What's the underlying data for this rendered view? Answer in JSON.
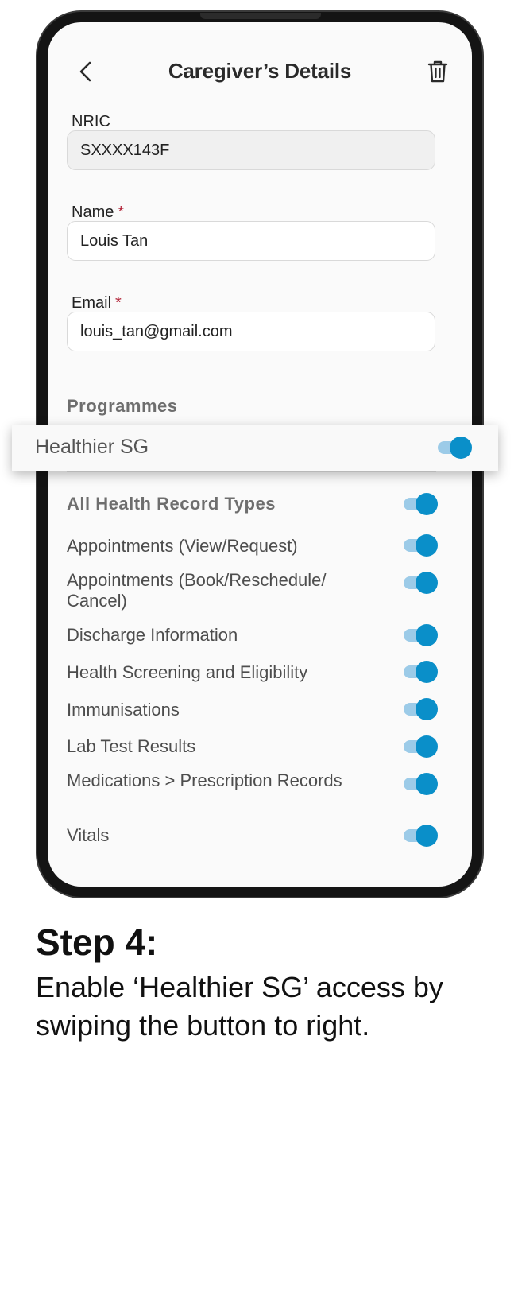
{
  "header": {
    "title": "Caregiver’s Details"
  },
  "form": {
    "nric": {
      "label": "NRIC",
      "value": "SXXXX143F"
    },
    "name": {
      "label": "Name",
      "required_mark": "*",
      "value": "Louis Tan"
    },
    "email": {
      "label": "Email",
      "required_mark": "*",
      "value": "louis_tan@gmail.com"
    }
  },
  "programmes": {
    "heading": "Programmes",
    "highlight": {
      "label": "Healthier SG",
      "enabled": true
    }
  },
  "records": {
    "all": {
      "label": "All Health Record Types",
      "enabled": true
    },
    "items": [
      {
        "label": "Appointments (View/Request)",
        "enabled": true
      },
      {
        "label": "Appointments (Book/Reschedule/ Cancel)",
        "enabled": true
      },
      {
        "label": "Discharge Information",
        "enabled": true
      },
      {
        "label": "Health Screening and Eligibility",
        "enabled": true
      },
      {
        "label": "Immunisations",
        "enabled": true
      },
      {
        "label": "Lab Test Results",
        "enabled": true
      },
      {
        "label": "Medications > Prescription Records",
        "enabled": true
      },
      {
        "label": "Vitals",
        "enabled": true
      }
    ]
  },
  "instruction": {
    "step": "Step 4:",
    "text": "Enable ‘Healthier SG’ access by swiping the button to right."
  },
  "colors": {
    "toggle_on": "#0a8fc9",
    "toggle_track": "#9ccbe8",
    "required": "#b3263a"
  },
  "icons": {
    "back": "chevron-left-icon",
    "delete": "trash-icon"
  }
}
